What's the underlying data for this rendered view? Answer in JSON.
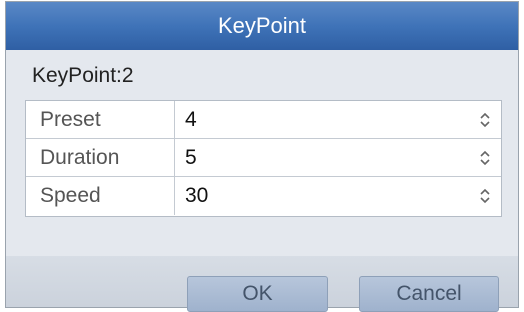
{
  "dialog": {
    "title": "KeyPoint",
    "subtitle": "KeyPoint:2"
  },
  "fields": [
    {
      "label": "Preset",
      "value": "4"
    },
    {
      "label": "Duration",
      "value": "5"
    },
    {
      "label": "Speed",
      "value": "30"
    }
  ],
  "buttons": {
    "ok_label": "OK",
    "cancel_label": "Cancel"
  },
  "colors": {
    "title_bar": "#3f73b8",
    "dialog_bg": "#e4e8ee",
    "button_bg": "#a9bbd4"
  },
  "icons": {
    "spinner": "up-down-spinner-icon"
  }
}
